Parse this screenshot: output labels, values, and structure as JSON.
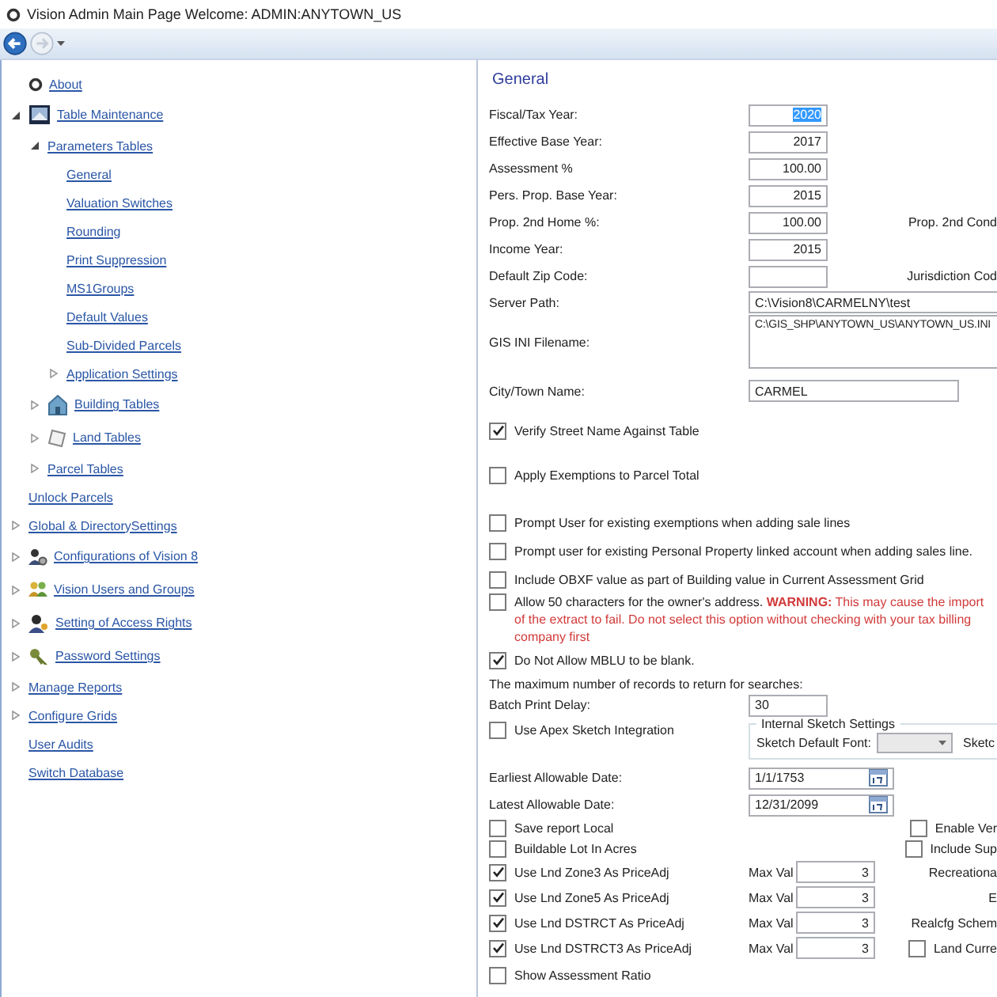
{
  "window": {
    "title": "Vision Admin Main Page  Welcome: ADMIN:ANYTOWN_US"
  },
  "tree": [
    {
      "label": "About",
      "kind": "about"
    },
    {
      "label": "Table Maintenance",
      "kind": "table",
      "expanded": true,
      "children": [
        {
          "label": "Parameters Tables",
          "expanded": true,
          "children": [
            {
              "label": "General"
            },
            {
              "label": "Valuation Switches"
            },
            {
              "label": "Rounding"
            },
            {
              "label": "Print Suppression"
            },
            {
              "label": "MS1Groups"
            },
            {
              "label": "Default Values"
            },
            {
              "label": "Sub-Divided Parcels"
            },
            {
              "label": "Application Settings",
              "expanded": false
            }
          ]
        },
        {
          "label": "Building Tables",
          "kind": "building",
          "expanded": false
        },
        {
          "label": "Land Tables",
          "kind": "land",
          "expanded": false
        },
        {
          "label": "Parcel Tables",
          "expanded": false
        }
      ]
    },
    {
      "label": "Unlock Parcels"
    },
    {
      "label": "Global & DirectorySettings",
      "expanded": false
    },
    {
      "label": "Configurations of Vision 8",
      "kind": "config",
      "expanded": false
    },
    {
      "label": "Vision Users and Groups",
      "kind": "users",
      "expanded": false
    },
    {
      "label": "Setting of Access Rights",
      "kind": "access",
      "expanded": false
    },
    {
      "label": "Password Settings",
      "kind": "password",
      "expanded": false
    },
    {
      "label": "Manage Reports",
      "expanded": false
    },
    {
      "label": "Configure Grids",
      "expanded": false
    },
    {
      "label": "User Audits"
    },
    {
      "label": "Switch Database"
    }
  ],
  "form": {
    "title": "General",
    "sections": [
      [
        {
          "kind": "number",
          "label": "Fiscal/Tax Year:",
          "value": "2020",
          "selected": true
        },
        {
          "kind": "number",
          "label": "Effective Base Year:",
          "value": "2017",
          "selected": false
        },
        {
          "kind": "number",
          "label": "Assessment %",
          "value": "100.00",
          "selected": false
        },
        {
          "kind": "number",
          "label": "Pers. Prop. Base Year:",
          "value": "2015",
          "selected": false
        },
        {
          "kind": "number",
          "label": "Prop. 2nd Home %:",
          "value": "100.00",
          "selected": false,
          "side": {
            "kind": "text",
            "label": "Prop. 2nd Cond"
          }
        },
        {
          "kind": "number",
          "label": "Income Year:",
          "value": "2015",
          "selected": false
        },
        {
          "kind": "number",
          "label": "Default Zip Code:",
          "side": {
            "kind": "text",
            "label": "Jurisdiction Cod"
          }
        },
        {
          "kind": "path",
          "label": "Server Path:",
          "value": "C:\\Vision8\\CARMELNY\\test"
        },
        {
          "kind": "multiline",
          "label": "GIS INI Filename:",
          "value": "C:\\GIS_SHP\\ANYTOWN_US\\ANYTOWN_US.INI"
        },
        {
          "kind": "name",
          "label": "City/Town Name:",
          "value": "CARMEL"
        }
      ],
      [
        {
          "kind": "check",
          "label": "Verify Street Name Against Table",
          "checked": true
        }
      ],
      [
        {
          "kind": "check",
          "label": "Apply Exemptions to Parcel Total",
          "checked": false
        }
      ],
      [
        {
          "kind": "check",
          "label": "Prompt User for existing exemptions when adding sale lines",
          "checked": false
        },
        {
          "kind": "check",
          "label": "Prompt user for existing Personal Property linked account when adding sales line.",
          "checked": false
        },
        {
          "kind": "check",
          "label": "Include OBXF value as part of Building value in Current Assessment Grid",
          "checked": false
        },
        {
          "kind": "warning-check",
          "label": "Allow 50 characters for the owner's address.",
          "warning_title": "WARNING:",
          "warning": "This may cause the import of the extract to fail.  Do not select this option without checking with your tax billing company first",
          "checked": false
        },
        {
          "kind": "check",
          "label": "Do Not Allow MBLU to be blank.",
          "checked": true
        },
        {
          "kind": "note",
          "label": "The maximum number of records to return for searches:"
        },
        {
          "kind": "short-text",
          "label": "Batch Print Delay:",
          "value": "30"
        },
        {
          "kind": "sketch",
          "label": "Use Apex Sketch Integration",
          "checked": false,
          "group_title": "Internal Sketch Settings",
          "font_label": "Sketch Default Font:",
          "side_label": "Sketc"
        },
        {
          "kind": "date",
          "label": "Earliest Allowable Date:",
          "value": "1/1/1753"
        },
        {
          "kind": "date",
          "label": "Latest Allowable Date:",
          "value": "12/31/2099"
        },
        {
          "kind": "check",
          "label": "Save report Local",
          "checked": false,
          "side": {
            "kind": "check",
            "label": "Enable Ver",
            "checked": false
          }
        },
        {
          "kind": "check",
          "label": "Buildable Lot In Acres",
          "checked": false,
          "side": {
            "kind": "check",
            "label": "Include Sup",
            "checked": false
          }
        },
        {
          "kind": "max-check",
          "label": "Use Lnd Zone3 As PriceAdj",
          "checked": true,
          "max_label": "Max Val",
          "max_value": "3",
          "side": {
            "kind": "text",
            "label": "Recreationa"
          }
        },
        {
          "kind": "max-check",
          "label": "Use Lnd Zone5 As PriceAdj",
          "checked": true,
          "max_label": "Max Val",
          "max_value": "3",
          "side": {
            "kind": "text",
            "label": "E"
          }
        },
        {
          "kind": "max-check",
          "label": "Use Lnd DSTRCT As PriceAdj",
          "checked": true,
          "max_label": "Max Val",
          "max_value": "3",
          "side": {
            "kind": "text",
            "label": "Realcfg Schem"
          }
        },
        {
          "kind": "max-check",
          "label": "Use Lnd DSTRCT3 As PriceAdj",
          "checked": true,
          "max_label": "Max Val",
          "max_value": "3",
          "side": {
            "kind": "check",
            "label": "Land Curre",
            "checked": false
          }
        },
        {
          "kind": "check",
          "label": "Show Assessment Ratio",
          "checked": false
        }
      ]
    ]
  }
}
